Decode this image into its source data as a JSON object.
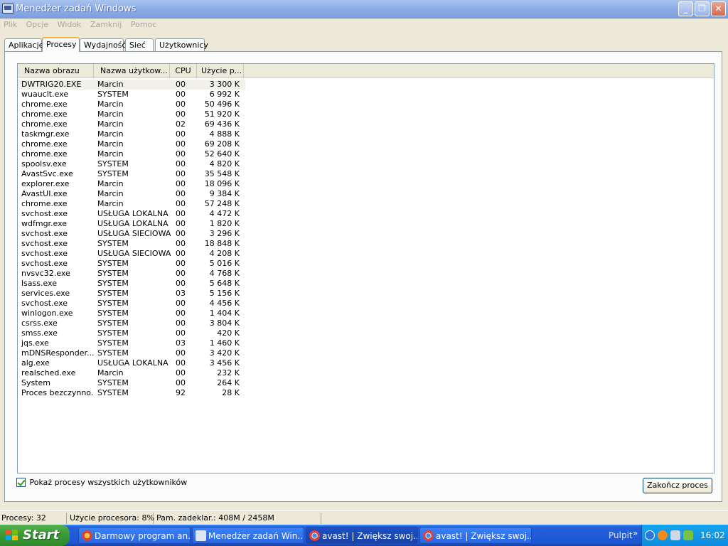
{
  "window": {
    "title": "Menedżer zadań Windows"
  },
  "menu": [
    "Plik",
    "Opcje",
    "Widok",
    "Zamknij",
    "Pomoc"
  ],
  "tabs": [
    {
      "label": "Aplikacje",
      "active": false
    },
    {
      "label": "Procesy",
      "active": true
    },
    {
      "label": "Wydajność",
      "active": false
    },
    {
      "label": "Sieć",
      "active": false
    },
    {
      "label": "Użytkownicy",
      "active": false
    }
  ],
  "columns": [
    "Nazwa obrazu",
    "Nazwa użytkow...",
    "CPU",
    "Użycie p..."
  ],
  "processes": [
    {
      "name": "DWTRIG20.EXE",
      "user": "Marcin",
      "cpu": "00",
      "mem": "3 300 K"
    },
    {
      "name": "wuauclt.exe",
      "user": "SYSTEM",
      "cpu": "00",
      "mem": "6 992 K"
    },
    {
      "name": "chrome.exe",
      "user": "Marcin",
      "cpu": "00",
      "mem": "50 496 K"
    },
    {
      "name": "chrome.exe",
      "user": "Marcin",
      "cpu": "00",
      "mem": "51 920 K"
    },
    {
      "name": "chrome.exe",
      "user": "Marcin",
      "cpu": "02",
      "mem": "69 436 K"
    },
    {
      "name": "taskmgr.exe",
      "user": "Marcin",
      "cpu": "00",
      "mem": "4 888 K"
    },
    {
      "name": "chrome.exe",
      "user": "Marcin",
      "cpu": "00",
      "mem": "69 208 K"
    },
    {
      "name": "chrome.exe",
      "user": "Marcin",
      "cpu": "00",
      "mem": "52 640 K"
    },
    {
      "name": "spoolsv.exe",
      "user": "SYSTEM",
      "cpu": "00",
      "mem": "4 820 K"
    },
    {
      "name": "AvastSvc.exe",
      "user": "SYSTEM",
      "cpu": "00",
      "mem": "35 548 K"
    },
    {
      "name": "explorer.exe",
      "user": "Marcin",
      "cpu": "00",
      "mem": "18 096 K"
    },
    {
      "name": "AvastUI.exe",
      "user": "Marcin",
      "cpu": "00",
      "mem": "9 384 K"
    },
    {
      "name": "chrome.exe",
      "user": "Marcin",
      "cpu": "00",
      "mem": "57 248 K"
    },
    {
      "name": "svchost.exe",
      "user": "USŁUGA LOKALNA",
      "cpu": "00",
      "mem": "4 472 K"
    },
    {
      "name": "wdfmgr.exe",
      "user": "USŁUGA LOKALNA",
      "cpu": "00",
      "mem": "1 820 K"
    },
    {
      "name": "svchost.exe",
      "user": "USŁUGA SIECIOWA",
      "cpu": "00",
      "mem": "3 296 K"
    },
    {
      "name": "svchost.exe",
      "user": "SYSTEM",
      "cpu": "00",
      "mem": "18 848 K"
    },
    {
      "name": "svchost.exe",
      "user": "USŁUGA SIECIOWA",
      "cpu": "00",
      "mem": "4 208 K"
    },
    {
      "name": "svchost.exe",
      "user": "SYSTEM",
      "cpu": "00",
      "mem": "5 016 K"
    },
    {
      "name": "nvsvc32.exe",
      "user": "SYSTEM",
      "cpu": "00",
      "mem": "4 768 K"
    },
    {
      "name": "lsass.exe",
      "user": "SYSTEM",
      "cpu": "00",
      "mem": "5 648 K"
    },
    {
      "name": "services.exe",
      "user": "SYSTEM",
      "cpu": "03",
      "mem": "5 156 K"
    },
    {
      "name": "svchost.exe",
      "user": "SYSTEM",
      "cpu": "00",
      "mem": "4 456 K"
    },
    {
      "name": "winlogon.exe",
      "user": "SYSTEM",
      "cpu": "00",
      "mem": "1 404 K"
    },
    {
      "name": "csrss.exe",
      "user": "SYSTEM",
      "cpu": "00",
      "mem": "3 804 K"
    },
    {
      "name": "smss.exe",
      "user": "SYSTEM",
      "cpu": "00",
      "mem": "420 K"
    },
    {
      "name": "jqs.exe",
      "user": "SYSTEM",
      "cpu": "03",
      "mem": "1 460 K"
    },
    {
      "name": "mDNSResponder....",
      "user": "SYSTEM",
      "cpu": "00",
      "mem": "3 420 K"
    },
    {
      "name": "alg.exe",
      "user": "USŁUGA LOKALNA",
      "cpu": "00",
      "mem": "3 456 K"
    },
    {
      "name": "realsched.exe",
      "user": "Marcin",
      "cpu": "00",
      "mem": "232 K"
    },
    {
      "name": "System",
      "user": "SYSTEM",
      "cpu": "00",
      "mem": "264 K"
    },
    {
      "name": "Proces bezczynno...",
      "user": "SYSTEM",
      "cpu": "92",
      "mem": "28 K"
    }
  ],
  "show_all_checkbox": {
    "label": "Pokaż procesy wszystkich użytkowników",
    "checked": true
  },
  "end_process_button": "Zakończ proces",
  "status": {
    "processes": "Procesy: 32",
    "cpu": "Użycie procesora: 8%",
    "memory": "Pam. zadeklar.: 408M / 2458M"
  },
  "taskbar": {
    "start": "Start",
    "tasks": [
      {
        "label": "Darmowy program an...",
        "icon": "chrome-icon",
        "active": false
      },
      {
        "label": "Menedżer zadań Win...",
        "icon": "taskmgr-icon",
        "active": false
      },
      {
        "label": "avast! | Zwiększ swoj...",
        "icon": "chrome-icon",
        "active": true
      },
      {
        "label": "avast! | Zwiększ swoj...",
        "icon": "chrome-icon",
        "active": false
      }
    ],
    "desktop_label": "Pulpit",
    "clock": "16:02"
  }
}
